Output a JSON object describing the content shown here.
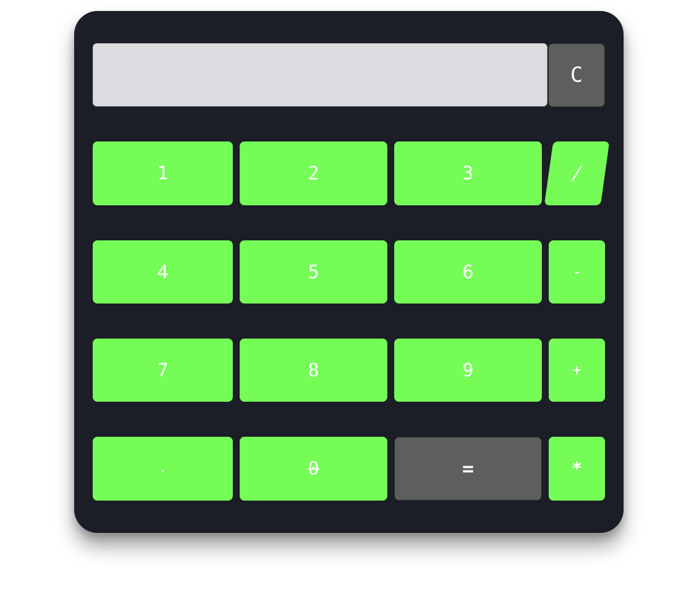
{
  "display": {
    "value": ""
  },
  "buttons": {
    "clear": "C",
    "one": "1",
    "two": "2",
    "three": "3",
    "divide": "/",
    "four": "4",
    "five": "5",
    "six": "6",
    "subtract": "-",
    "seven": "7",
    "eight": "8",
    "nine": "9",
    "add": "+",
    "decimal": ".",
    "zero": "0",
    "equals": "=",
    "multiply": "*"
  },
  "colors": {
    "body": "#1b1d27",
    "display": "#dcdce0",
    "key": "#75fc57",
    "key_dark": "#5c5f5d",
    "key_text": "#ffffff"
  }
}
